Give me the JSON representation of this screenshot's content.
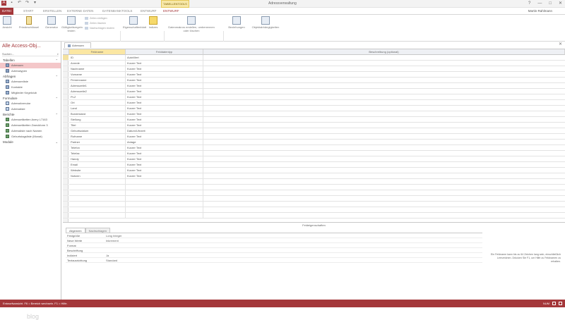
{
  "window": {
    "title": "Adressverwaltung",
    "tools_badge": "TABELLENTOOLS",
    "user": "Martin Rahlmann",
    "controls": [
      "?",
      "—",
      "□",
      "✕"
    ]
  },
  "ribbon_tabs": [
    {
      "label": "DATEI",
      "active": true
    },
    {
      "label": "START",
      "active": false
    },
    {
      "label": "ERSTELLEN",
      "active": false
    },
    {
      "label": "EXTERNE DATEN",
      "active": false
    },
    {
      "label": "DATENBANKTOOLS",
      "active": false
    },
    {
      "label": "ENTWURF",
      "active": false
    },
    {
      "label": "ENTWURF",
      "active": false
    }
  ],
  "ribbon": {
    "buttons": [
      {
        "label": "Ansicht"
      },
      {
        "label": "Primärschlüssel"
      },
      {
        "label": "Generator"
      },
      {
        "label": "Gültigkeitsregeln testen"
      },
      {
        "label": "Eigenschaftenblatt"
      },
      {
        "label": "Indizes"
      },
      {
        "label": "Datenmakros erstellen, umbenennen oder löschen"
      },
      {
        "label": "Beziehungen"
      },
      {
        "label": "Objektabhängigkeiten"
      }
    ],
    "small_items": [
      "Zeilen einfügen",
      "Zeilen löschen",
      "Nachschlagen ändern"
    ],
    "groups": [
      "Ansichten",
      "Tools",
      "Einblenden/Ausblenden",
      "Feld-, Datensatz- und Tabellenereignisse",
      "Beziehungen"
    ]
  },
  "nav_pane": {
    "title": "Alle Access-Obj...",
    "search_placeholder": "Suchen...",
    "sections": [
      {
        "label": "Tabellen",
        "items": [
          {
            "label": "Adressen",
            "selected": true,
            "kind": "table"
          },
          {
            "label": "Adresstypen",
            "selected": false,
            "kind": "table"
          }
        ]
      },
      {
        "label": "Abfragen",
        "items": [
          {
            "label": "Adressenliste",
            "selected": false,
            "kind": "query"
          },
          {
            "label": "Kontakte",
            "selected": false,
            "kind": "query"
          },
          {
            "label": "Mitglieder Kegelclub",
            "selected": false,
            "kind": "query"
          }
        ]
      },
      {
        "label": "Formulare",
        "items": [
          {
            "label": "Adressformular",
            "selected": false,
            "kind": "form"
          },
          {
            "label": "Adressliste",
            "selected": false,
            "kind": "form"
          }
        ]
      },
      {
        "label": "Berichte",
        "items": [
          {
            "label": "Adressetiketten Avery L7163",
            "selected": false,
            "kind": "report"
          },
          {
            "label": "Adressetiketten Zweckform 3",
            "selected": false,
            "kind": "report"
          },
          {
            "label": "Adressliste nach Namen",
            "selected": false,
            "kind": "report"
          },
          {
            "label": "Geburtstagsliste (Monat)",
            "selected": false,
            "kind": "report"
          }
        ]
      },
      {
        "label": "Module",
        "items": []
      }
    ],
    "watermark": "blog"
  },
  "document": {
    "tab_label": "Adressen",
    "headers": [
      "Feldname",
      "Felddatentyp",
      "Beschreibung (optional)"
    ],
    "fields": [
      {
        "name": "ID",
        "type": "AutoWert"
      },
      {
        "name": "Anrede",
        "type": "Kurzer Text"
      },
      {
        "name": "Nachname",
        "type": "Kurzer Text"
      },
      {
        "name": "Vorname",
        "type": "Kurzer Text"
      },
      {
        "name": "Firmenname",
        "type": "Kurzer Text"
      },
      {
        "name": "Adresszeile1",
        "type": "Kurzer Text"
      },
      {
        "name": "Adresszeile2",
        "type": "Kurzer Text"
      },
      {
        "name": "PLZ",
        "type": "Kurzer Text"
      },
      {
        "name": "Ort",
        "type": "Kurzer Text"
      },
      {
        "name": "Land",
        "type": "Kurzer Text"
      },
      {
        "name": "Bundesland",
        "type": "Kurzer Text"
      },
      {
        "name": "Stellung",
        "type": "Kurzer Text"
      },
      {
        "name": "Titel",
        "type": "Kurzer Text"
      },
      {
        "name": "Geburtsdatum",
        "type": "Datum/Uhrzeit"
      },
      {
        "name": "Rufname",
        "type": "Kurzer Text"
      },
      {
        "name": "Partner",
        "type": "Anlage"
      },
      {
        "name": "Telefon",
        "type": "Kurzer Text"
      },
      {
        "name": "Telefax",
        "type": "Kurzer Text"
      },
      {
        "name": "Handy",
        "type": "Kurzer Text"
      },
      {
        "name": "Email",
        "type": "Kurzer Text"
      },
      {
        "name": "Website",
        "type": "Kurzer Text"
      },
      {
        "name": "Notizen",
        "type": "Kurzer Text"
      }
    ]
  },
  "properties": {
    "title": "Feldeigenschaften",
    "tabs": [
      "Allgemein",
      "Nachschlagen"
    ],
    "rows": [
      {
        "label": "Feldgröße",
        "value": "Long Integer"
      },
      {
        "label": "Neue Werte",
        "value": "Inkrement"
      },
      {
        "label": "Format",
        "value": ""
      },
      {
        "label": "Beschriftung",
        "value": ""
      },
      {
        "label": "Indiziert",
        "value": "Ja"
      },
      {
        "label": "Textausrichtung",
        "value": "Standard"
      }
    ],
    "help": "Ein Feldname kann bis zu 64 Zeichen lang sein, einschließlich Leerzeichen. Drücken Sie F1, um Hilfe zu Feldnamen zu erhalten."
  },
  "status": {
    "left": "Entwurfsansicht. F6 = Bereich wechseln. F1 = Hilfe.",
    "indicator": "NUM"
  },
  "colors": {
    "accent": "#a4373a",
    "selected_nav": "#f4c7c9",
    "selected_header": "#fbe7a3"
  }
}
